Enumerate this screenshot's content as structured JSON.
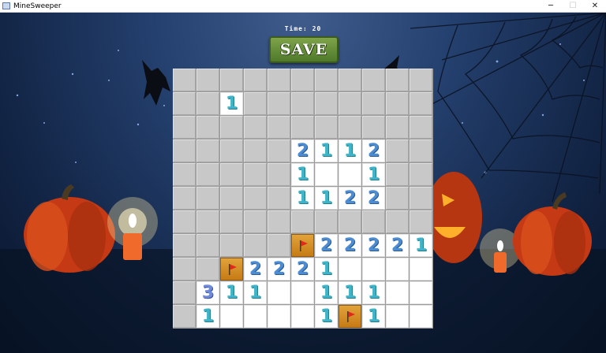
{
  "window": {
    "title": "MineSweeper",
    "minimize": "─",
    "maximize": "☐",
    "close": "✕"
  },
  "hud": {
    "time_text": "Time: 20",
    "save_label": "SAVE"
  },
  "board": {
    "cols": 11,
    "rows": 11,
    "grid": [
      "HHHHHHHHHHH",
      "HH1HHHHHHHH",
      "HHHHHHHHHHH",
      "HHHHH2112HH",
      "HHHHH1OO1HH",
      "HHHHH1122HH",
      "HHHHHHHHHHH",
      "HHHHHF22221",
      "HHF2221OOOO",
      "H311OO111OO",
      "H1OOOO1F1OO"
    ]
  },
  "icons": {
    "flag": "flag-icon"
  }
}
